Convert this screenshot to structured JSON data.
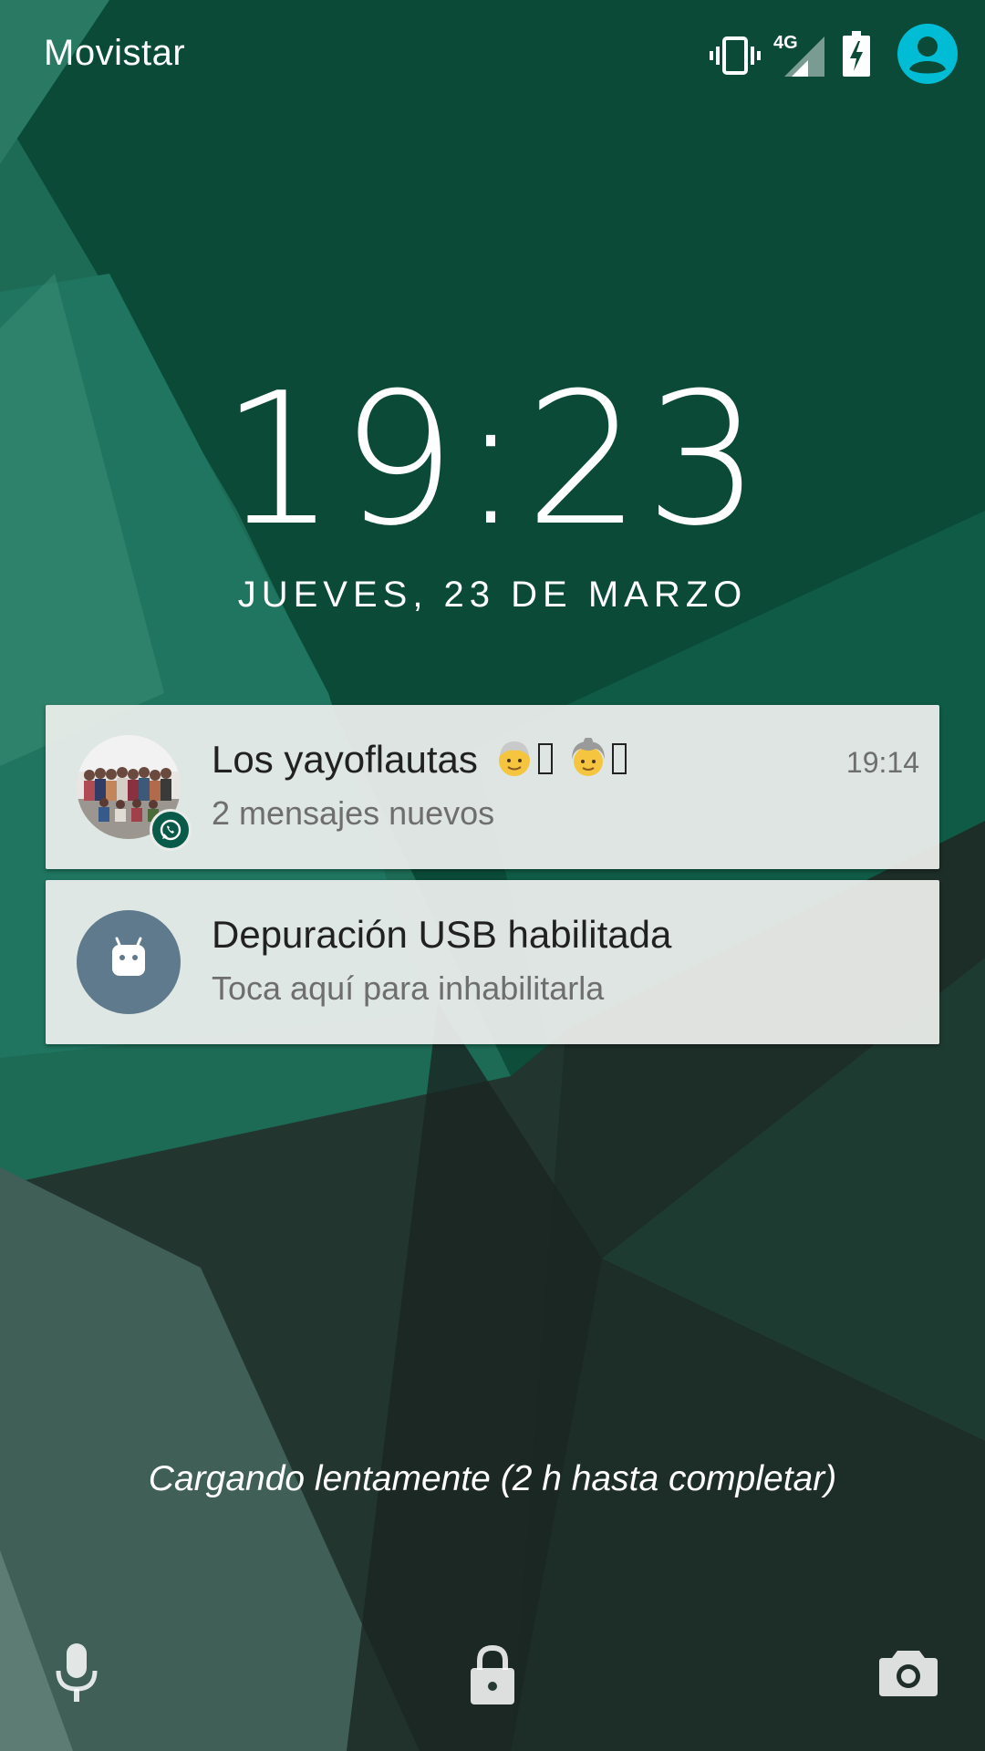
{
  "status_bar": {
    "carrier": "Movistar",
    "network_label": "4G",
    "icons": [
      "vibrate-icon",
      "signal-icon",
      "battery-charging-icon",
      "user-icon"
    ]
  },
  "clock": {
    "time": "19:23",
    "date": "JUEVES, 23 DE MARZO"
  },
  "notifications": [
    {
      "title": "Los yayoflautas",
      "subtitle": "2 mensajes nuevos",
      "time": "19:14",
      "app_icon": "whatsapp-icon"
    },
    {
      "title": "Depuración USB habilitada",
      "subtitle": "Toca aquí para inhabilitarla",
      "app_icon": "android-debug-icon"
    }
  ],
  "charging_text": "Cargando lentamente (2 h hasta completar)",
  "bottom_icons": [
    "mic-icon",
    "lock-icon",
    "camera-icon"
  ],
  "colors": {
    "accent": "#00bcd4",
    "notification_bg": "#eef0ee",
    "whatsapp": "#0a5a4a"
  }
}
